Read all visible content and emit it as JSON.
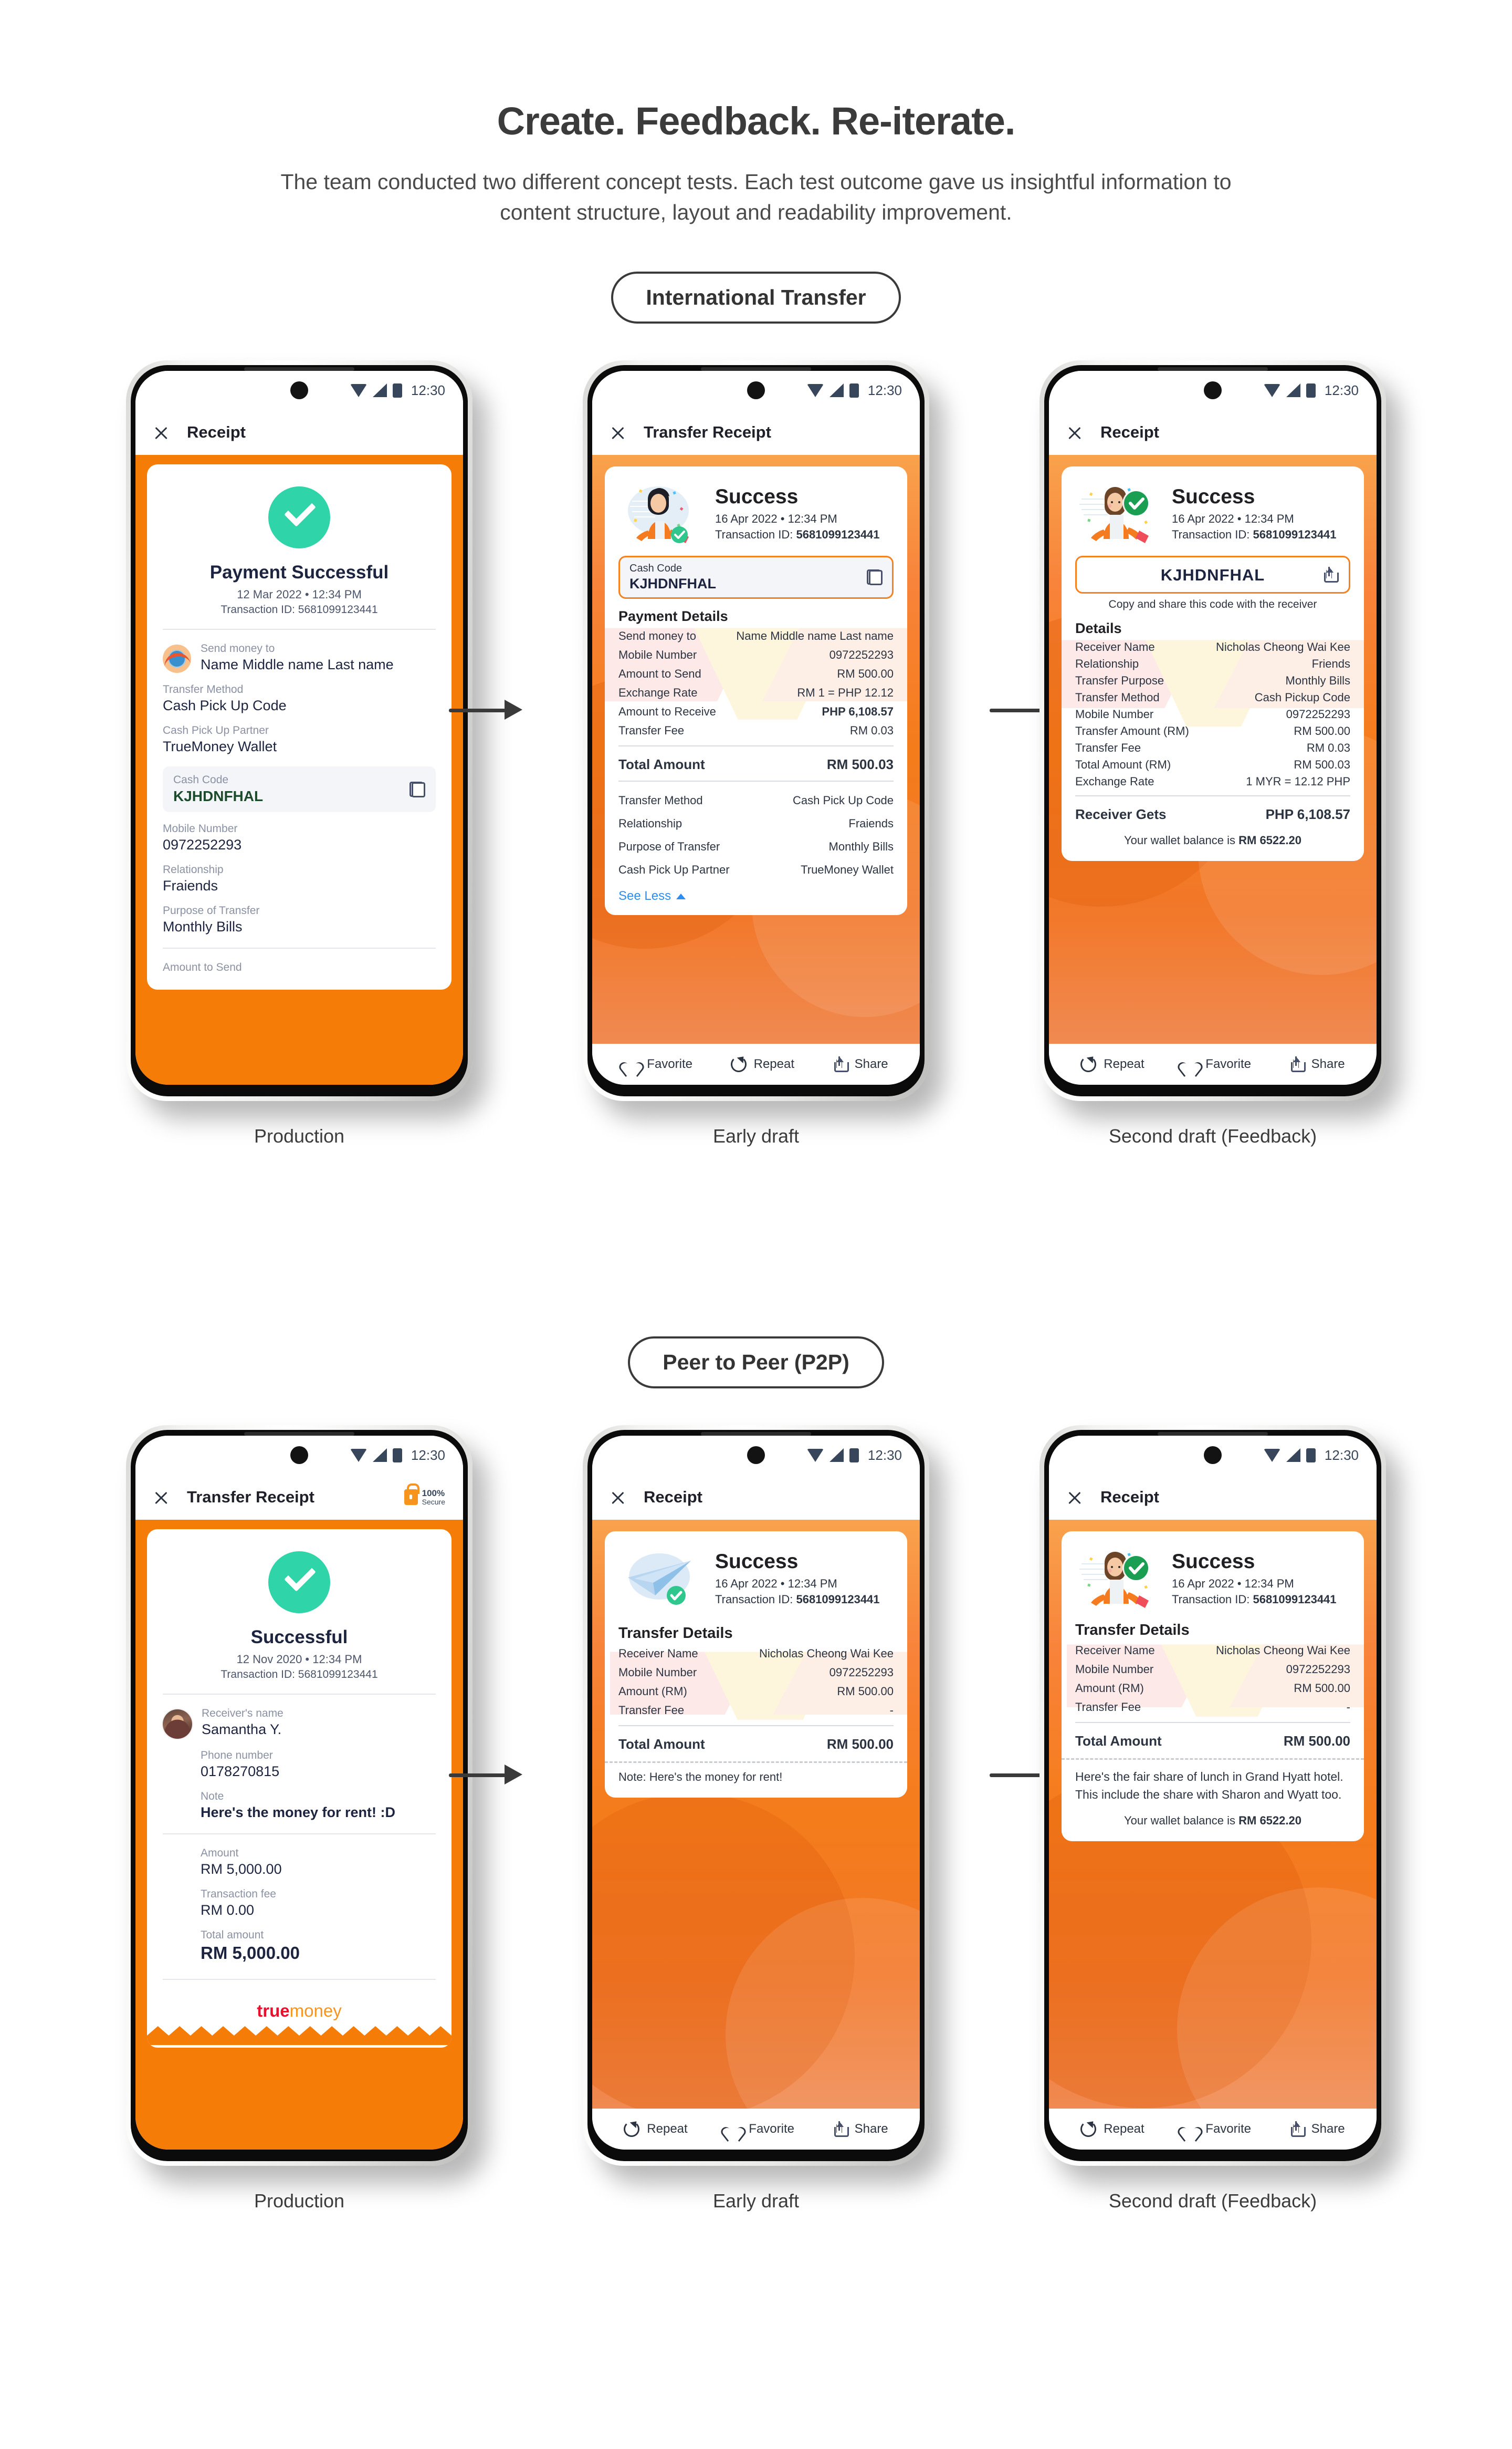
{
  "header": {
    "title": "Create. Feedback. Re-iterate.",
    "subtitle": "The team conducted two different concept tests. Each test outcome gave us insightful information to content structure, layout and readability improvement."
  },
  "colors": {
    "brand_orange": "#f57c06",
    "success_green": "#2fd4a8",
    "accent_blue": "#2b8ef0",
    "truemoney_red": "#e8112d"
  },
  "sections": [
    {
      "pill": "International Transfer",
      "captions": [
        "Production",
        "Early draft",
        "Second draft (Feedback)"
      ]
    },
    {
      "pill": "Peer to Peer (P2P)",
      "captions": [
        "Production",
        "Early draft",
        "Second draft (Feedback)"
      ]
    }
  ],
  "status_bar": {
    "time": "12:30"
  },
  "intl_production": {
    "appbar_title": "Receipt",
    "success_title": "Payment Successful",
    "date": "12 Mar 2022 • 12:34 PM",
    "txid": "Transaction ID: 5681099123441",
    "rows": [
      {
        "label": "Send money to",
        "value": "Name Middle name Last name"
      },
      {
        "label": "Transfer Method",
        "value": "Cash Pick Up Code"
      },
      {
        "label": "Cash Pick Up Partner",
        "value": "TrueMoney Wallet"
      }
    ],
    "code_label": "Cash Code",
    "code_value": "KJHDNFHAL",
    "rows2": [
      {
        "label": "Mobile Number",
        "value": "0972252293"
      },
      {
        "label": "Relationship",
        "value": "Fraiends"
      },
      {
        "label": "Purpose of Transfer",
        "value": "Monthly Bills"
      }
    ],
    "cut_label": "Amount to Send"
  },
  "intl_early": {
    "appbar_title": "Transfer Receipt",
    "hero_title": "Success",
    "hero_date": "16 Apr 2022 • 12:34 PM",
    "hero_txid_label": "Transaction ID: ",
    "hero_txid_value": "5681099123441",
    "code_label": "Cash Code",
    "code_value": "KJHDNFHAL",
    "section_head": "Payment Details",
    "rows": [
      {
        "k": "Send money to",
        "v": "Name Middle name Last name"
      },
      {
        "k": "Mobile Number",
        "v": "0972252293"
      },
      {
        "k": "Amount to Send",
        "v": "RM 500.00"
      },
      {
        "k": "Exchange Rate",
        "v": "RM 1 = PHP 12.12"
      },
      {
        "k": "Amount to Receive",
        "v": "PHP 6,108.57"
      },
      {
        "k": "Transfer Fee",
        "v": "RM 0.03"
      }
    ],
    "total_label": "Total Amount",
    "total_value": "RM 500.03",
    "rows2": [
      {
        "k": "Transfer Method",
        "v": "Cash Pick Up Code"
      },
      {
        "k": "Relationship",
        "v": "Fraiends"
      },
      {
        "k": "Purpose of Transfer",
        "v": "Monthly Bills"
      },
      {
        "k": "Cash Pick Up Partner",
        "v": "TrueMoney Wallet"
      }
    ],
    "see_less": "See Less",
    "actions": [
      "Favorite",
      "Repeat",
      "Share"
    ]
  },
  "intl_second": {
    "appbar_title": "Receipt",
    "hero_title": "Success",
    "hero_date": "16 Apr 2022 • 12:34 PM",
    "hero_txid_label": "Transaction ID: ",
    "hero_txid_value": "5681099123441",
    "code_value": "KJHDNFHAL",
    "code_hint": "Copy and share this code with the receiver",
    "section_head": "Details",
    "rows": [
      {
        "k": "Receiver Name",
        "v": "Nicholas Cheong Wai Kee"
      },
      {
        "k": "Relationship",
        "v": "Friends"
      },
      {
        "k": "Transfer Purpose",
        "v": "Monthly Bills"
      },
      {
        "k": "Transfer Method",
        "v": "Cash Pickup Code"
      },
      {
        "k": "Mobile Number",
        "v": "0972252293"
      },
      {
        "k": "Transfer Amount (RM)",
        "v": "RM 500.00"
      },
      {
        "k": "Transfer Fee",
        "v": "RM 0.03"
      },
      {
        "k": "Total Amount (RM)",
        "v": "RM 500.03"
      },
      {
        "k": "Exchange Rate",
        "v": "1 MYR = 12.12 PHP"
      }
    ],
    "total_label": "Receiver Gets",
    "total_value": "PHP 6,108.57",
    "balance_prefix": "Your wallet balance is ",
    "balance_value": "RM 6522.20",
    "actions": [
      "Repeat",
      "Favorite",
      "Share"
    ]
  },
  "p2p_production": {
    "appbar_title": "Transfer Receipt",
    "secure_pct": "100%",
    "secure_word": "Secure",
    "success_title": "Successful",
    "date": "12 Nov 2020 • 12:34 PM",
    "txid": "Transaction ID: 5681099123441",
    "rows": [
      {
        "label": "Receiver's name",
        "value": "Samantha Y."
      },
      {
        "label": "Phone number",
        "value": "0178270815"
      },
      {
        "label": "Note",
        "value": "Here's the money for rent! :D"
      }
    ],
    "rows2": [
      {
        "label": "Amount",
        "value": "RM 5,000.00"
      },
      {
        "label": "Transaction fee",
        "value": "RM 0.00"
      },
      {
        "label": "Total amount",
        "value": "RM 5,000.00"
      }
    ],
    "logo_true": "true",
    "logo_money": "money"
  },
  "p2p_early": {
    "appbar_title": "Receipt",
    "hero_title": "Success",
    "hero_date": "16 Apr 2022 • 12:34 PM",
    "hero_txid_label": "Transaction ID: ",
    "hero_txid_value": "5681099123441",
    "section_head": "Transfer Details",
    "rows": [
      {
        "k": "Receiver Name",
        "v": "Nicholas Cheong Wai Kee"
      },
      {
        "k": "Mobile Number",
        "v": "0972252293"
      },
      {
        "k": "Amount (RM)",
        "v": "RM 500.00"
      },
      {
        "k": "Transfer Fee",
        "v": "-"
      }
    ],
    "total_label": "Total Amount",
    "total_value": "RM 500.00",
    "note": "Note: Here's the money for rent!",
    "actions": [
      "Repeat",
      "Favorite",
      "Share"
    ]
  },
  "p2p_second": {
    "appbar_title": "Receipt",
    "hero_title": "Success",
    "hero_date": "16 Apr 2022 • 12:34 PM",
    "hero_txid_label": "Transaction ID: ",
    "hero_txid_value": "5681099123441",
    "section_head": "Transfer Details",
    "rows": [
      {
        "k": "Receiver Name",
        "v": "Nicholas Cheong Wai Kee"
      },
      {
        "k": "Mobile Number",
        "v": "0972252293"
      },
      {
        "k": "Amount (RM)",
        "v": "RM 500.00"
      },
      {
        "k": "Transfer Fee",
        "v": "-"
      }
    ],
    "total_label": "Total Amount",
    "total_value": "RM 500.00",
    "note": "Here's the fair share of lunch in Grand Hyatt hotel. This include the share with Sharon and Wyatt too.",
    "balance_prefix": "Your wallet balance is ",
    "balance_value": "RM 6522.20",
    "actions": [
      "Repeat",
      "Favorite",
      "Share"
    ]
  }
}
